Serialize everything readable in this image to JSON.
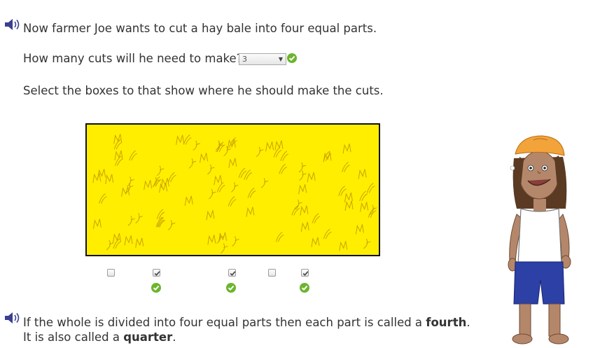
{
  "intro": {
    "line": "Now farmer Joe wants to cut a hay bale into four equal parts."
  },
  "question": {
    "prompt": "How many cuts will he need to make?",
    "selected_value": "3"
  },
  "instruction": "Select the boxes to that show where he should make the cuts.",
  "checkboxes": [
    {
      "checked": false
    },
    {
      "checked": true,
      "correct": true
    },
    {
      "checked": true,
      "correct": true
    },
    {
      "checked": false
    },
    {
      "checked": true,
      "correct": true
    }
  ],
  "explanation": {
    "line1_pre": "If the whole is divided into four equal parts then each part is called a ",
    "line1_bold": "fourth",
    "line1_post": ".",
    "line2_pre": "It is also called a ",
    "line2_bold": "quarter",
    "line2_post": "."
  },
  "icons": {
    "speaker": "speaker-icon",
    "correct": "green-check-icon"
  },
  "colors": {
    "hay_fill": "#ffee00",
    "hay_stroke": "#c9a300",
    "check_green": "#6cb52d",
    "speaker_blue": "#3b3f8f",
    "cap_orange": "#f2a33a"
  }
}
